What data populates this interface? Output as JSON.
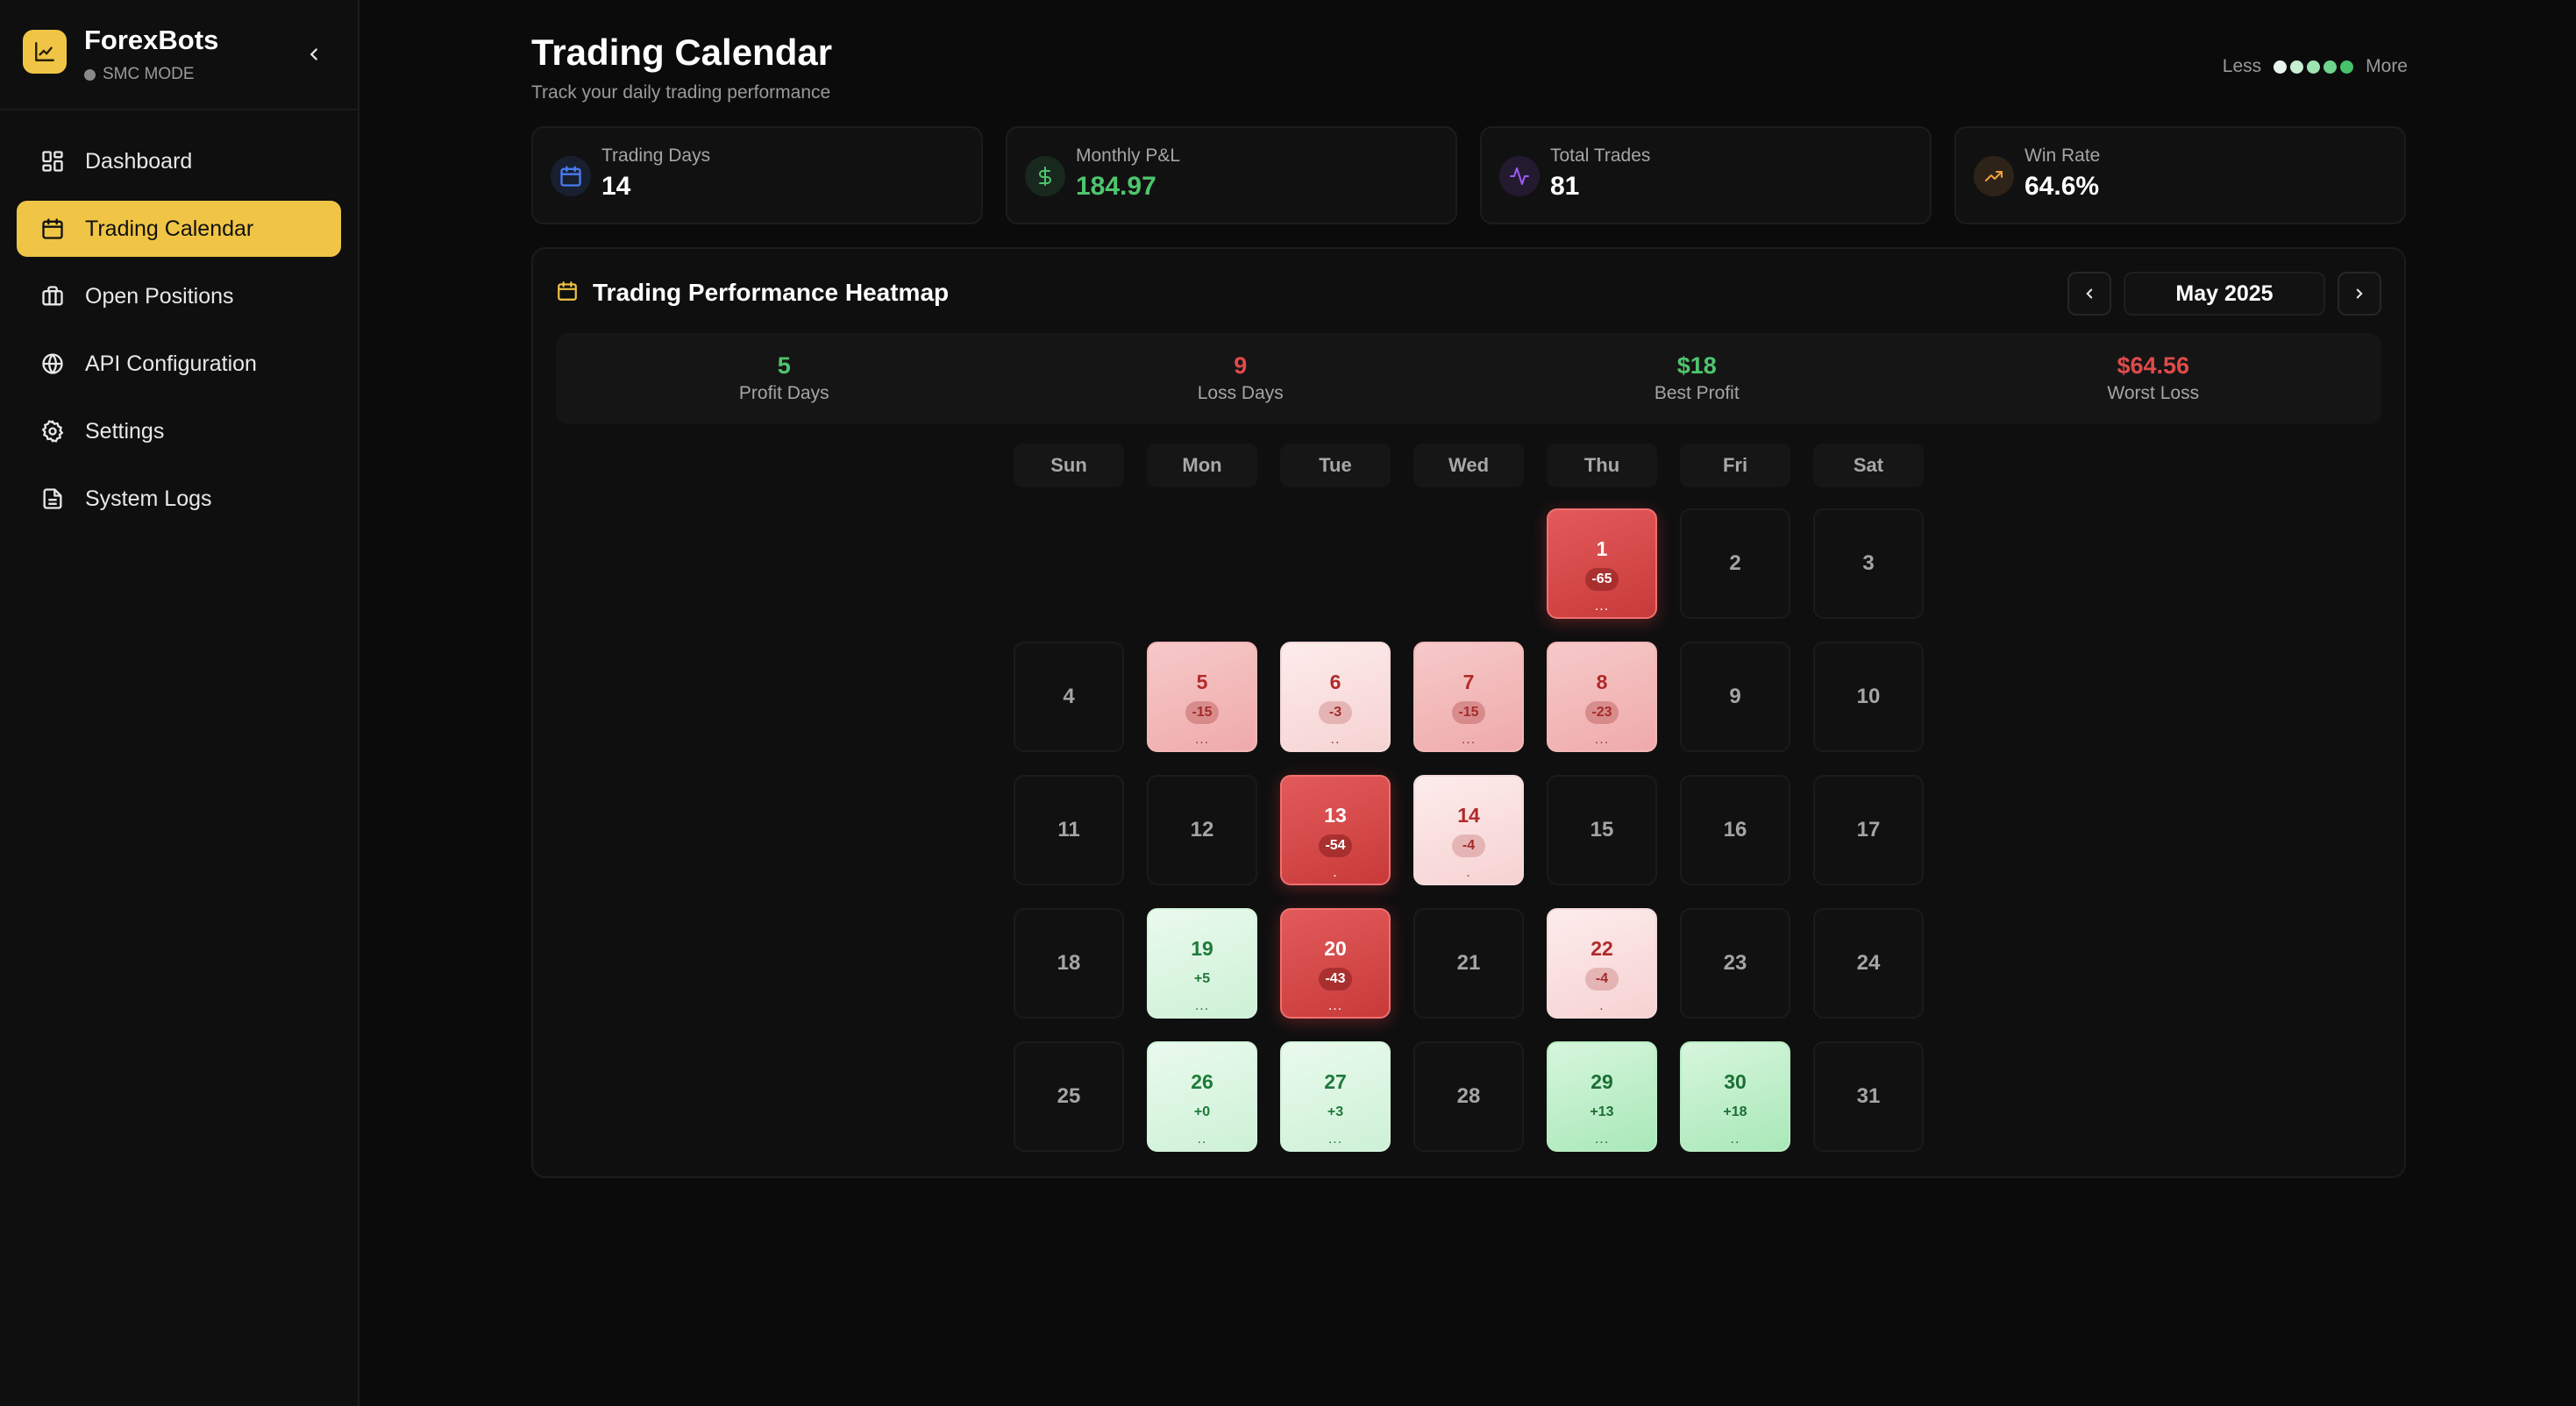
{
  "brand": {
    "name": "ForexBots",
    "mode": "SMC MODE"
  },
  "nav": [
    {
      "label": "Dashboard",
      "icon": "dashboard-icon",
      "active": false
    },
    {
      "label": "Trading Calendar",
      "icon": "calendar-icon",
      "active": true
    },
    {
      "label": "Open Positions",
      "icon": "briefcase-icon",
      "active": false
    },
    {
      "label": "API Configuration",
      "icon": "globe-icon",
      "active": false
    },
    {
      "label": "Settings",
      "icon": "gear-icon",
      "active": false
    },
    {
      "label": "System Logs",
      "icon": "file-text-icon",
      "active": false
    }
  ],
  "header": {
    "title": "Trading Calendar",
    "subtitle": "Track your daily trading performance",
    "legend_less": "Less",
    "legend_more": "More",
    "legend_colors": [
      "#e8f5ec",
      "#c9efd3",
      "#9fe3b2",
      "#6fd48c",
      "#45c26a"
    ]
  },
  "stats": [
    {
      "label": "Trading Days",
      "value": "14",
      "icon": "calendar-icon",
      "accent": "#4a7cf0"
    },
    {
      "label": "Monthly P&L",
      "value": "184.97",
      "icon": "dollar-icon",
      "accent": "#4fc56e"
    },
    {
      "label": "Total Trades",
      "value": "81",
      "icon": "activity-icon",
      "accent": "#9b5cf0"
    },
    {
      "label": "Win Rate",
      "value": "64.6%",
      "icon": "trending-up-icon",
      "accent": "#f0a040"
    }
  ],
  "panel": {
    "title": "Trading Performance Heatmap",
    "month": "May 2025",
    "summary": [
      {
        "value": "5",
        "label": "Profit Days",
        "tone": "g"
      },
      {
        "value": "9",
        "label": "Loss Days",
        "tone": "r"
      },
      {
        "value": "$18",
        "label": "Best Profit",
        "tone": "g"
      },
      {
        "value": "$64.56",
        "label": "Worst Loss",
        "tone": "r"
      }
    ],
    "weekdays": [
      "Sun",
      "Mon",
      "Tue",
      "Wed",
      "Thu",
      "Fri",
      "Sat"
    ]
  },
  "calendar": {
    "weeks": [
      [
        null,
        null,
        null,
        null,
        {
          "day": "1",
          "pnl": "-65",
          "dots": "...",
          "shade": "loss-strong"
        },
        {
          "day": "2"
        },
        {
          "day": "3"
        }
      ],
      [
        {
          "day": "4"
        },
        {
          "day": "5",
          "pnl": "-15",
          "dots": "...",
          "shade": "loss-med"
        },
        {
          "day": "6",
          "pnl": "-3",
          "dots": "..",
          "shade": "loss-light"
        },
        {
          "day": "7",
          "pnl": "-15",
          "dots": "...",
          "shade": "loss-med"
        },
        {
          "day": "8",
          "pnl": "-23",
          "dots": "...",
          "shade": "loss-med"
        },
        {
          "day": "9"
        },
        {
          "day": "10"
        }
      ],
      [
        {
          "day": "11"
        },
        {
          "day": "12"
        },
        {
          "day": "13",
          "pnl": "-54",
          "dots": ".",
          "shade": "loss-strong"
        },
        {
          "day": "14",
          "pnl": "-4",
          "dots": ".",
          "shade": "loss-light"
        },
        {
          "day": "15"
        },
        {
          "day": "16"
        },
        {
          "day": "17"
        }
      ],
      [
        {
          "day": "18"
        },
        {
          "day": "19",
          "pnl": "+5",
          "dots": "...",
          "shade": "prof-light"
        },
        {
          "day": "20",
          "pnl": "-43",
          "dots": "...",
          "shade": "loss-strong"
        },
        {
          "day": "21"
        },
        {
          "day": "22",
          "pnl": "-4",
          "dots": ".",
          "shade": "loss-light"
        },
        {
          "day": "23"
        },
        {
          "day": "24"
        }
      ],
      [
        {
          "day": "25"
        },
        {
          "day": "26",
          "pnl": "+0",
          "dots": "..",
          "shade": "prof-light"
        },
        {
          "day": "27",
          "pnl": "+3",
          "dots": "...",
          "shade": "prof-light"
        },
        {
          "day": "28"
        },
        {
          "day": "29",
          "pnl": "+13",
          "dots": "...",
          "shade": "prof-med"
        },
        {
          "day": "30",
          "pnl": "+18",
          "dots": "..",
          "shade": "prof-med"
        },
        {
          "day": "31"
        }
      ]
    ]
  }
}
